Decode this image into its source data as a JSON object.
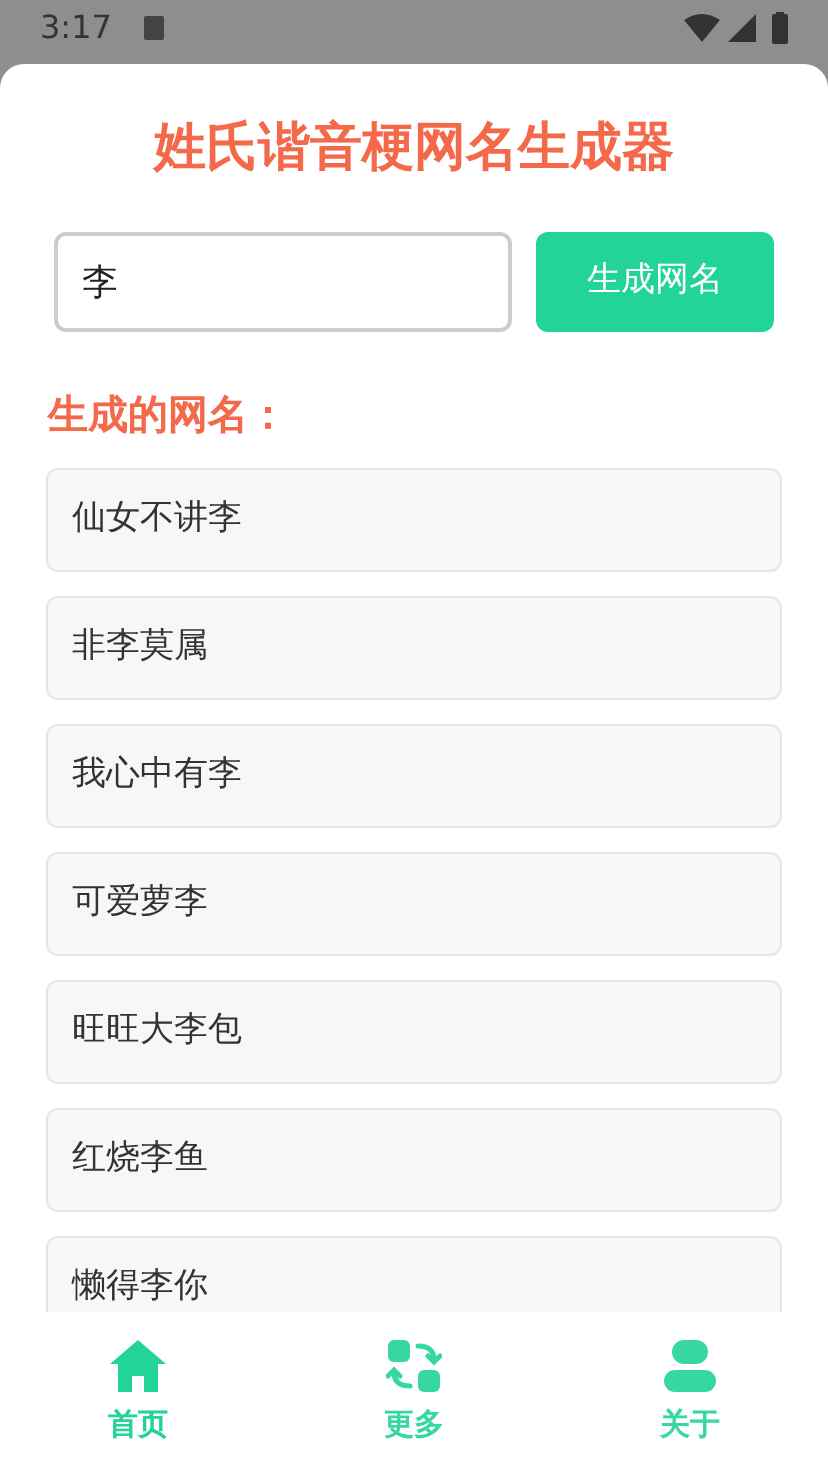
{
  "status_bar": {
    "time": "3:17"
  },
  "title": "姓氏谐音梗网名生成器",
  "input": {
    "value": "李"
  },
  "generate_button": "生成网名",
  "results_heading": "生成的网名：",
  "results": [
    "仙女不讲李",
    "非李莫属",
    "我心中有李",
    "可爱萝李",
    "旺旺大李包",
    "红烧李鱼",
    "懒得李你"
  ],
  "nav": [
    {
      "label": "首页",
      "selected": true
    },
    {
      "label": "更多",
      "selected": false
    },
    {
      "label": "关于",
      "selected": false
    }
  ]
}
